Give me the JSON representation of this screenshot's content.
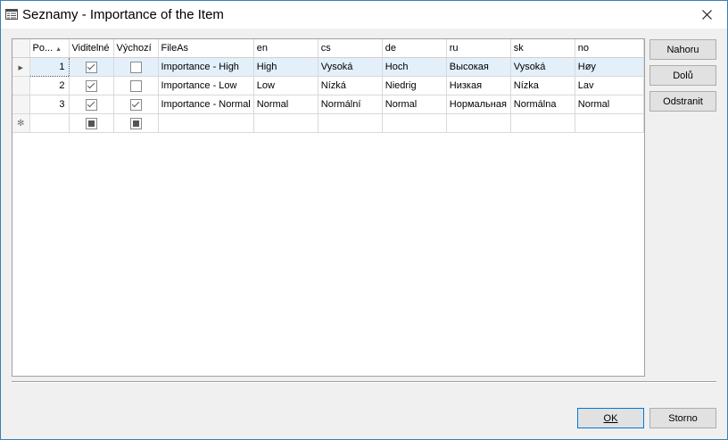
{
  "window": {
    "title": "Seznamy - Importance of the Item"
  },
  "grid": {
    "columns": [
      "Po...",
      "Viditelné",
      "Výchozí",
      "FileAs",
      "en",
      "cs",
      "de",
      "ru",
      "sk",
      "no"
    ],
    "rows": [
      {
        "order": "1",
        "visible": true,
        "default": false,
        "fileas": "Importance - High",
        "en": "High",
        "cs": "Vysoká",
        "de": "Hoch",
        "ru": "Высокая",
        "sk": "Vysoká",
        "no": "Høy"
      },
      {
        "order": "2",
        "visible": true,
        "default": false,
        "fileas": "Importance - Low",
        "en": "Low",
        "cs": "Nízká",
        "de": "Niedrig",
        "ru": "Низкая",
        "sk": "Nízka",
        "no": "Lav"
      },
      {
        "order": "3",
        "visible": true,
        "default": true,
        "fileas": "Importance - Normal",
        "en": "Normal",
        "cs": "Normální",
        "de": "Normal",
        "ru": "Нормальная",
        "sk": "Normálna",
        "no": "Normal"
      }
    ]
  },
  "buttons": {
    "up": "Nahoru",
    "down": "Dolů",
    "remove": "Odstranit",
    "ok": "OK",
    "cancel": "Storno"
  }
}
